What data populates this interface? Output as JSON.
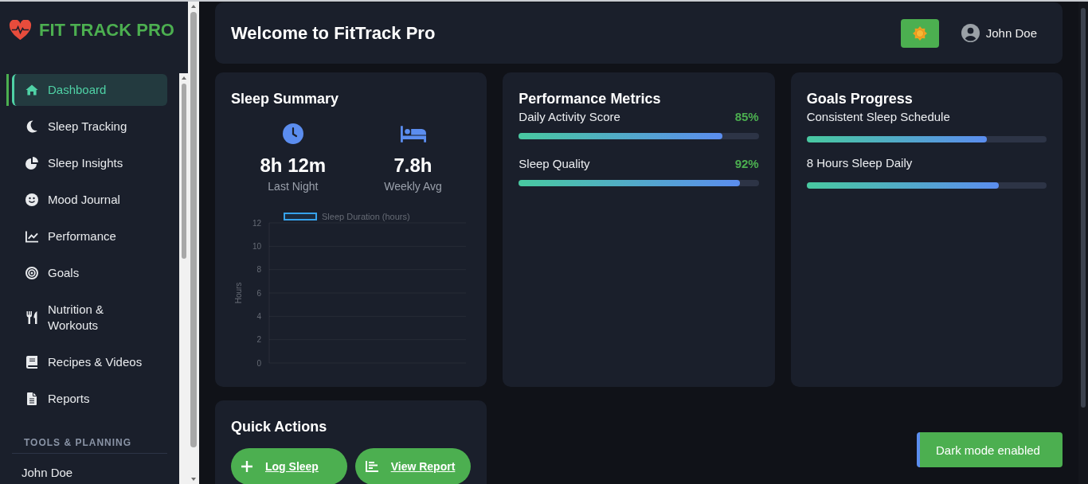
{
  "sidebar": {
    "logo": "FIT TRACK PRO",
    "nav": [
      {
        "label": "Dashboard",
        "selected": true
      },
      {
        "label": "Sleep Tracking",
        "selected": false
      },
      {
        "label": "Sleep Insights",
        "selected": false
      },
      {
        "label": "Mood Journal",
        "selected": false
      },
      {
        "label": "Performance",
        "selected": false
      },
      {
        "label": "Goals",
        "selected": false
      },
      {
        "label": "Nutrition & Workouts",
        "selected": false
      },
      {
        "label": "Recipes & Videos",
        "selected": false
      },
      {
        "label": "Reports",
        "selected": false
      }
    ],
    "tools": {
      "heading": "TOOLS & PLANNING",
      "items": [
        "John Doe"
      ]
    }
  },
  "header": {
    "title": "Welcome to FitTrack Pro",
    "user": "John Doe"
  },
  "sleep_summary": {
    "title": "Sleep Summary",
    "stats": [
      {
        "value": "8h 12m",
        "label": "Last Night"
      },
      {
        "value": "7.8h",
        "label": "Weekly Avg"
      }
    ],
    "chart_data": {
      "type": "bar",
      "ylabel": "Hours",
      "ylim": [
        0,
        12
      ],
      "yticks": [
        0,
        2,
        4,
        6,
        8,
        10,
        12
      ],
      "grid": true,
      "series": [
        {
          "name": "Sleep Duration (hours)",
          "color": "#36a2eb"
        }
      ]
    }
  },
  "performance": {
    "title": "Performance Metrics",
    "metrics": [
      {
        "name": "Daily Activity Score",
        "reading": "85%",
        "level": 0.85
      },
      {
        "name": "Sleep Quality",
        "reading": "92%",
        "level": 0.92
      }
    ]
  },
  "goals": {
    "title": "Goals Progress",
    "items": [
      {
        "name": "Consistent Sleep Schedule",
        "level": 0.75
      },
      {
        "name": "8 Hours Sleep Daily",
        "level": 0.8
      }
    ]
  },
  "quick_actions": {
    "title": "Quick Actions",
    "buttons": [
      "Log Sleep",
      "View Report"
    ]
  },
  "toast": {
    "message": "Dark mode enabled"
  }
}
